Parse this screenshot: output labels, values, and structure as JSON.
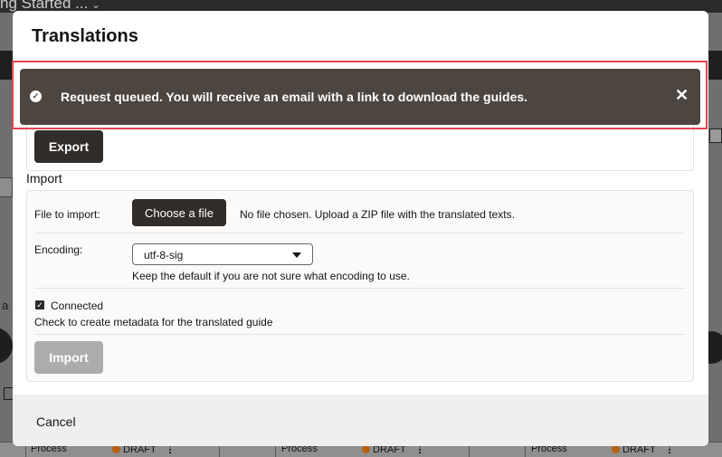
{
  "background": {
    "page_title": "ng Started ...",
    "left_partial_text": "a",
    "table_rows": [
      {
        "label": "Process",
        "status": "DRAFT"
      },
      {
        "label": "Process",
        "status": "DRAFT"
      },
      {
        "label": "Process",
        "status": "DRAFT"
      }
    ]
  },
  "dialog": {
    "title": "Translations",
    "export": {
      "button_label": "Export"
    },
    "import": {
      "section_label": "Import",
      "file_label": "File to import:",
      "choose_button": "Choose a file",
      "no_file_text": "No file chosen. Upload a ZIP file with the translated texts.",
      "encoding_label": "Encoding:",
      "encoding_value": "utf-8-sig",
      "encoding_hint": "Keep the default if you are not sure what encoding to use.",
      "connected_label": "Connected",
      "connected_checked": true,
      "connected_hint": "Check to create metadata for the translated guide",
      "import_button": "Import"
    },
    "footer": {
      "cancel_label": "Cancel"
    }
  },
  "toast": {
    "message": "Request queued. You will receive an email with a link to download the guides.",
    "icon": "check-circle-icon",
    "close_icon": "close-icon",
    "highlight_color": "#e0474f"
  }
}
